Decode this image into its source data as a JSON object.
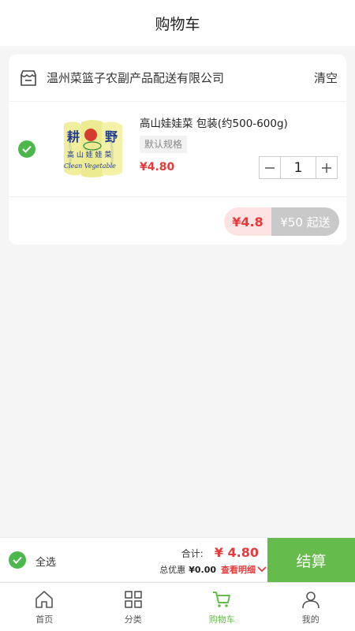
{
  "header": {
    "title": "购物车"
  },
  "shop": {
    "name": "温州菜篮子农副产品配送有限公司",
    "clear_label": "清空"
  },
  "item": {
    "name": "高山娃娃菜 包装(约500-600g)",
    "spec": "默认规格",
    "price": "¥4.80",
    "quantity": "1",
    "image_icon": "cabbage-package-icon"
  },
  "summary_pill": {
    "amount": "¥4.8",
    "minimum": "¥50 起送"
  },
  "checkout": {
    "select_all_label": "全选",
    "total_label": "合计:",
    "total_value": "¥ 4.80",
    "discount_label": "总优惠",
    "discount_value": "¥0.00",
    "detail_label": "查看明细",
    "submit_label": "结算"
  },
  "tabs": [
    {
      "label": "首页",
      "icon": "home-icon"
    },
    {
      "label": "分类",
      "icon": "grid-icon"
    },
    {
      "label": "购物车",
      "icon": "cart-icon",
      "active": true
    },
    {
      "label": "我的",
      "icon": "user-icon"
    }
  ],
  "colors": {
    "accent": "#65bb4b",
    "price": "#e63a3a",
    "check": "#4cb84c"
  }
}
